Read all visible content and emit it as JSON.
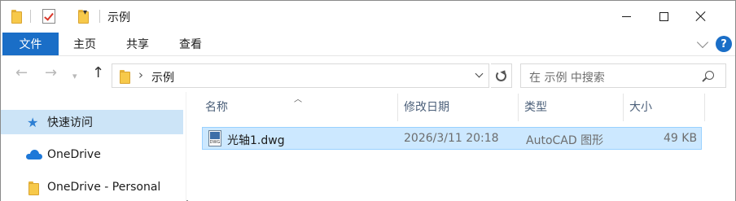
{
  "window": {
    "title": "示例",
    "minimize_icon": "minimize-icon",
    "maximize_icon": "maximize-icon",
    "close_icon": "close-icon"
  },
  "ribbon": {
    "file_tab": "文件",
    "tabs": [
      "主页",
      "共享",
      "查看"
    ],
    "help_label": "?",
    "accent_color": "#1a6ec7"
  },
  "address_bar": {
    "path": "示例",
    "separator": "›",
    "search_placeholder": "在 示例 中搜索"
  },
  "nav_pane": {
    "items": [
      {
        "label": "快速访问",
        "icon": "star-icon",
        "selected": true
      },
      {
        "label": "OneDrive",
        "icon": "cloud-icon",
        "selected": false
      },
      {
        "label": "OneDrive - Personal",
        "icon": "folder-icon",
        "selected": false
      }
    ]
  },
  "file_list": {
    "columns": [
      "名称",
      "修改日期",
      "类型",
      "大小"
    ],
    "rows": [
      {
        "name": "光轴1.dwg",
        "modified": "2026/3/11 20:18",
        "type": "AutoCAD 图形",
        "size": "49 KB",
        "icon": "dwg-file-icon",
        "selected": true
      }
    ]
  }
}
